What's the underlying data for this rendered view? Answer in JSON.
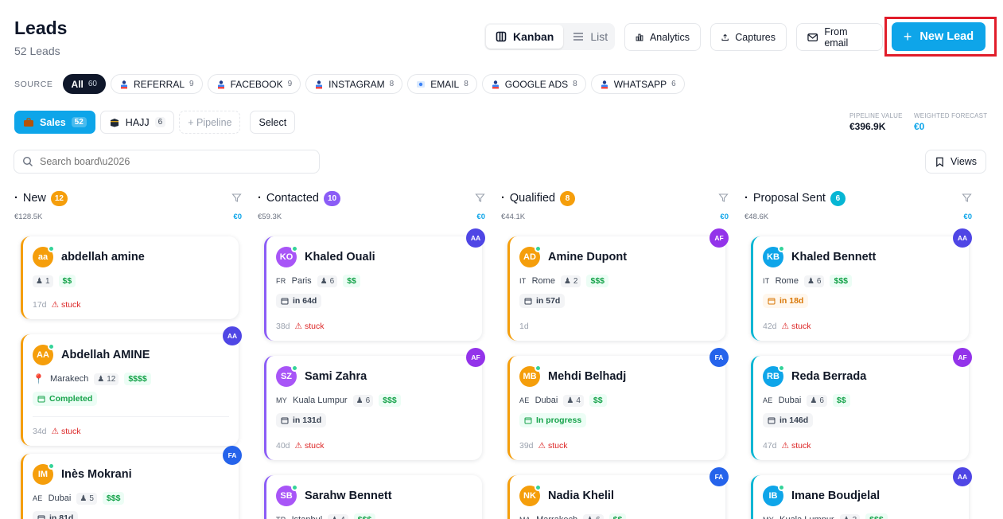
{
  "header": {
    "title": "Leads",
    "subtitle": "52 Leads"
  },
  "views": {
    "kanban": "Kanban",
    "list": "List"
  },
  "actions": {
    "analytics": "Analytics",
    "captures": "Captures",
    "from_email": "From email",
    "new_lead": "New Lead"
  },
  "source": {
    "label": "SOURCE",
    "chips": [
      {
        "label": "All",
        "count": "60"
      },
      {
        "label": "REFERRAL",
        "count": "9"
      },
      {
        "label": "FACEBOOK",
        "count": "9"
      },
      {
        "label": "INSTAGRAM",
        "count": "8"
      },
      {
        "label": "EMAIL",
        "count": "8"
      },
      {
        "label": "GOOGLE ADS",
        "count": "8"
      },
      {
        "label": "WHATSAPP",
        "count": "6"
      }
    ]
  },
  "pipelines": {
    "items": [
      {
        "label": "Sales",
        "count": "52"
      },
      {
        "label": "HAJJ",
        "count": "6"
      }
    ],
    "add": "+ Pipeline",
    "select": "Select"
  },
  "stats": {
    "pipeline_value_label": "PIPELINE VALUE",
    "pipeline_value": "€396.9K",
    "weighted_forecast_label": "WEIGHTED FORECAST",
    "weighted_forecast": "€0"
  },
  "search": {
    "placeholder": "Search board\\u2026"
  },
  "views_button": "Views",
  "colors": {
    "accent": "#0ea5e9",
    "stuck": "#dc2626",
    "price": "#16a34a"
  },
  "columns": [
    {
      "name": "New",
      "count": "12",
      "color": "#f59e0b",
      "total": "€128.5K",
      "weighted": "€0",
      "cards": [
        {
          "initials": "aa",
          "avatar_color": "#f59e0b",
          "name": "abdellah amine",
          "pax": "1",
          "price": "$$",
          "age": "17d",
          "stuck": "stuck"
        },
        {
          "initials": "AA",
          "avatar_color": "#f59e0b",
          "name": "Abdellah AMINE",
          "location": "Marakech",
          "pax": "12",
          "price": "$$$$",
          "status": "Completed",
          "age": "34d",
          "stuck": "stuck",
          "owner": "AA"
        },
        {
          "initials": "IM",
          "avatar_color": "#f59e0b",
          "name": "Inès Mokrani",
          "cc": "AE",
          "location": "Dubai",
          "pax": "5",
          "price": "$$$",
          "due": "in 81d",
          "owner": "FA"
        }
      ]
    },
    {
      "name": "Contacted",
      "count": "10",
      "color": "#8b5cf6",
      "total": "€59.3K",
      "weighted": "€0",
      "cards": [
        {
          "initials": "KO",
          "avatar_color": "#a855f7",
          "name": "Khaled Ouali",
          "cc": "FR",
          "location": "Paris",
          "pax": "6",
          "price": "$$",
          "due": "in 64d",
          "age": "38d",
          "stuck": "stuck",
          "owner": "AA"
        },
        {
          "initials": "SZ",
          "avatar_color": "#a855f7",
          "name": "Sami Zahra",
          "cc": "MY",
          "location": "Kuala Lumpur",
          "pax": "6",
          "price": "$$$",
          "due": "in 131d",
          "age": "40d",
          "stuck": "stuck",
          "owner": "AF"
        },
        {
          "initials": "SB",
          "avatar_color": "#a855f7",
          "name": "Sarahw Bennett",
          "cc": "TR",
          "location": "Istanbul",
          "pax": "4",
          "price": "$$$"
        }
      ]
    },
    {
      "name": "Qualified",
      "count": "8",
      "color": "#f59e0b",
      "total": "€44.1K",
      "weighted": "€0",
      "cards": [
        {
          "initials": "AD",
          "avatar_color": "#f59e0b",
          "name": "Amine Dupont",
          "cc": "IT",
          "location": "Rome",
          "pax": "2",
          "price": "$$$",
          "due": "in 57d",
          "age": "1d",
          "owner": "AF"
        },
        {
          "initials": "MB",
          "avatar_color": "#f59e0b",
          "name": "Mehdi Belhadj",
          "cc": "AE",
          "location": "Dubai",
          "pax": "4",
          "price": "$$",
          "status": "In progress",
          "age": "39d",
          "stuck": "stuck",
          "owner": "FA"
        },
        {
          "initials": "NK",
          "avatar_color": "#f59e0b",
          "name": "Nadia Khelil",
          "cc": "MA",
          "location": "Marrakech",
          "pax": "6",
          "price": "$$",
          "owner": "FA"
        }
      ]
    },
    {
      "name": "Proposal Sent",
      "count": "6",
      "color": "#06b6d4",
      "total": "€48.6K",
      "weighted": "€0",
      "cards": [
        {
          "initials": "KB",
          "avatar_color": "#0ea5e9",
          "name": "Khaled Bennett",
          "cc": "IT",
          "location": "Rome",
          "pax": "6",
          "price": "$$$",
          "due": "in 18d",
          "due_tone": "orange",
          "age": "42d",
          "stuck": "stuck",
          "owner": "AA"
        },
        {
          "initials": "RB",
          "avatar_color": "#0ea5e9",
          "name": "Reda Berrada",
          "cc": "AE",
          "location": "Dubai",
          "pax": "6",
          "price": "$$",
          "due": "in 146d",
          "age": "47d",
          "stuck": "stuck",
          "owner": "AF"
        },
        {
          "initials": "IB",
          "avatar_color": "#0ea5e9",
          "name": "Imane Boudjelal",
          "cc": "MY",
          "location": "Kuala Lumpur",
          "pax": "3",
          "price": "$$$",
          "owner": "AA"
        }
      ]
    }
  ]
}
